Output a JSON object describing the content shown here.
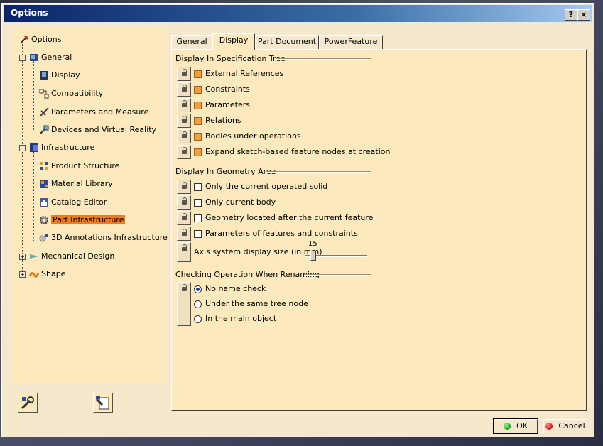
{
  "window": {
    "title": "Options",
    "help_label": "?",
    "close_label": "×"
  },
  "tree": {
    "root": "Options",
    "items": [
      {
        "label": "General",
        "level": 1,
        "icon": "general-icon"
      },
      {
        "label": "Display",
        "level": 2,
        "icon": "display-icon"
      },
      {
        "label": "Compatibility",
        "level": 2,
        "icon": "compatibility-icon"
      },
      {
        "label": "Parameters and Measure",
        "level": 2,
        "icon": "parameters-icon"
      },
      {
        "label": "Devices and Virtual Reality",
        "level": 2,
        "icon": "devices-icon"
      },
      {
        "label": "Infrastructure",
        "level": 1,
        "icon": "infrastructure-icon"
      },
      {
        "label": "Product Structure",
        "level": 2,
        "icon": "product-structure-icon"
      },
      {
        "label": "Material Library",
        "level": 2,
        "icon": "material-library-icon"
      },
      {
        "label": "Catalog Editor",
        "level": 2,
        "icon": "catalog-editor-icon"
      },
      {
        "label": "Part Infrastructure",
        "level": 2,
        "icon": "gear-icon"
      },
      {
        "label": "3D Annotations Infrastructure",
        "level": 2,
        "icon": "annotations-icon"
      },
      {
        "label": "Mechanical Design",
        "level": 1,
        "icon": "mechanical-design-icon"
      },
      {
        "label": "Shape",
        "level": 1,
        "icon": "shape-icon"
      }
    ]
  },
  "tabs": [
    "General",
    "Display",
    "Part Document",
    "PowerFeature"
  ],
  "active_tab": "Display",
  "sections": {
    "spec_tree": {
      "title": "Display In Specification Tree",
      "options": [
        "External References",
        "Constraints",
        "Parameters",
        "Relations",
        "Bodies under operations",
        "Expand sketch-based feature nodes at creation"
      ]
    },
    "geometry_area": {
      "title": "Display In Geometry Area",
      "options": [
        "Only the current operated solid",
        "Only current body",
        "Geometry located after the current feature",
        "Parameters of features and constraints"
      ],
      "axis_label": "Axis system display size (in mm)",
      "axis_value": "15"
    },
    "renaming": {
      "title": "Checking Operation When Renaming",
      "options": [
        "No name check",
        "Under the same tree node",
        "In the main object"
      ]
    }
  },
  "buttons": {
    "ok": "OK",
    "cancel": "Cancel"
  },
  "colors": {
    "ok_dot": "#20b020",
    "cancel_dot": "#e02020",
    "selected": "#f07a20"
  }
}
